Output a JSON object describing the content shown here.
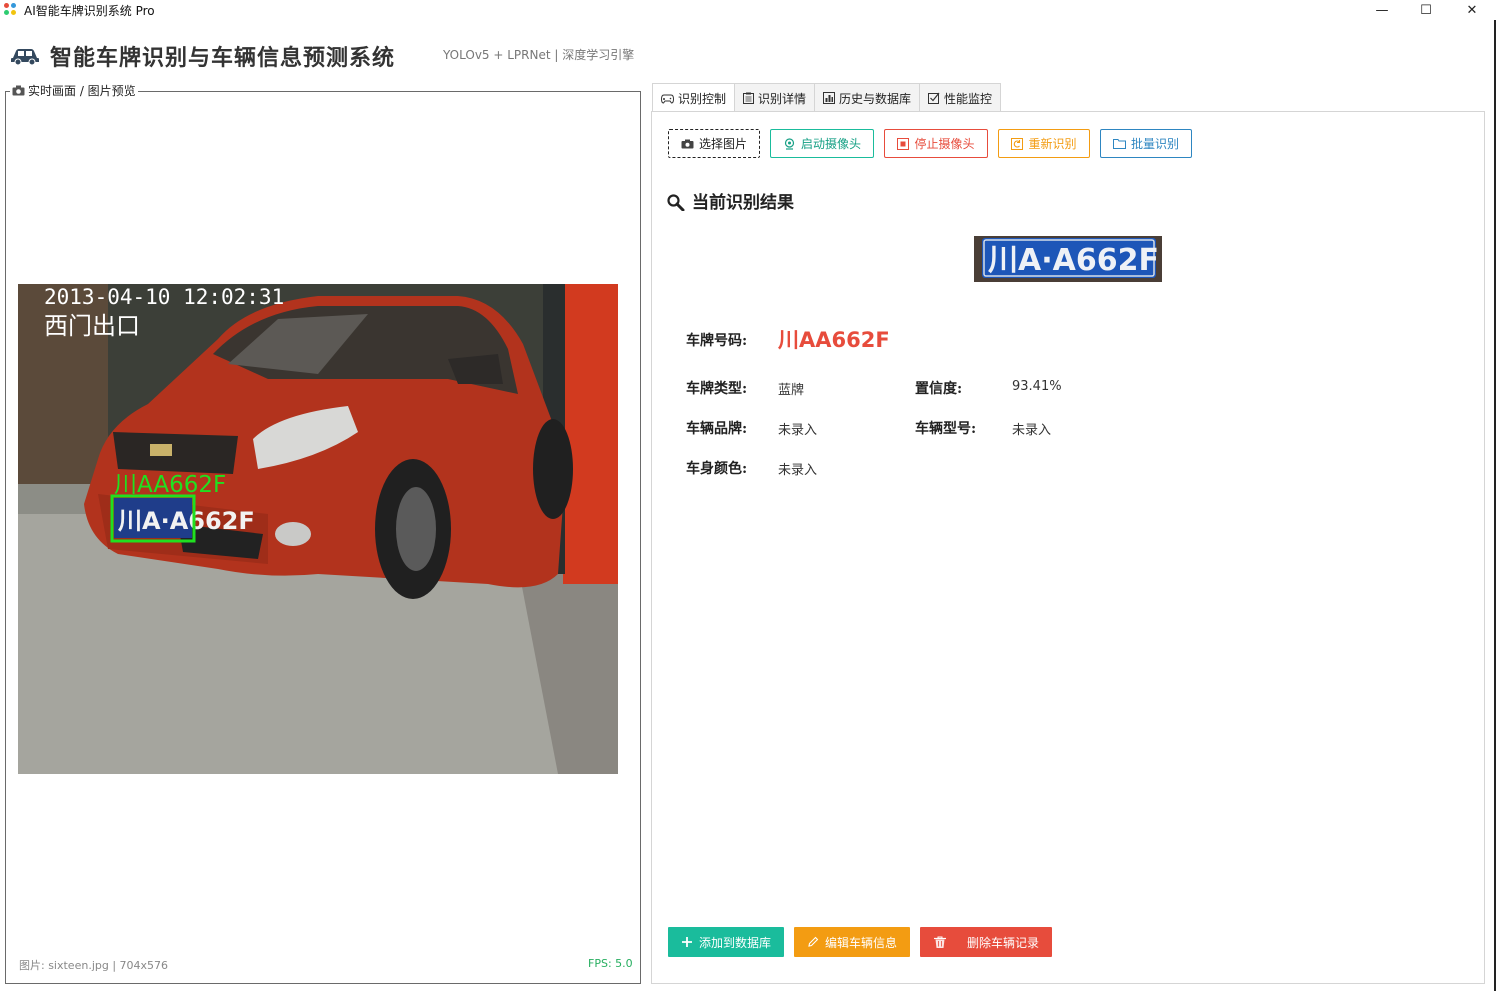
{
  "window": {
    "title": "AI智能车牌识别系统 Pro",
    "controls": [
      "—",
      "☐",
      "✕"
    ]
  },
  "header": {
    "title": "智能车牌识别与车辆信息预测系统",
    "subtitle": "YOLOv5 + LPRNet | 深度学习引擎"
  },
  "preview": {
    "legend": "实时画面 / 图片预览",
    "overlay_timestamp": "2013-04-10 12:02:31",
    "overlay_location": "西门出口",
    "detected_label": "川AA662F",
    "plate_text": "川A·A662F",
    "footer_info": "图片: sixteen.jpg | 704x576",
    "fps": "FPS: 5.0"
  },
  "tabs": [
    {
      "label": "识别控制",
      "icon": "gamepad-icon",
      "active": true
    },
    {
      "label": "识别详情",
      "icon": "clipboard-icon",
      "active": false
    },
    {
      "label": "历史与数据库",
      "icon": "bar-chart-icon",
      "active": false
    },
    {
      "label": "性能监控",
      "icon": "checkbox-icon",
      "active": false
    }
  ],
  "controls": {
    "select_image": "选择图片",
    "start_camera": "启动摄像头",
    "stop_camera": "停止摄像头",
    "re_recognize": "重新识别",
    "batch_recognize": "批量识别"
  },
  "result": {
    "section_title": "当前识别结果",
    "plate_crop_text": "川A·A662F",
    "plate_number_label": "车牌号码:",
    "plate_number": "川AA662F",
    "plate_type_label": "车牌类型:",
    "plate_type": "蓝牌",
    "confidence_label": "置信度:",
    "confidence": "93.41%",
    "brand_label": "车辆品牌:",
    "brand": "未录入",
    "model_label": "车辆型号:",
    "model": "未录入",
    "color_label": "车身颜色:",
    "color": "未录入"
  },
  "actions": {
    "add_db": "添加到数据库",
    "edit_vehicle": "编辑车辆信息",
    "delete_record": "删除车辆记录"
  },
  "colors": {
    "teal": "#1abc9c",
    "orange": "#f39c12",
    "red": "#e74c3c",
    "blue": "#2e86c1",
    "fps_green": "#27ae60"
  }
}
